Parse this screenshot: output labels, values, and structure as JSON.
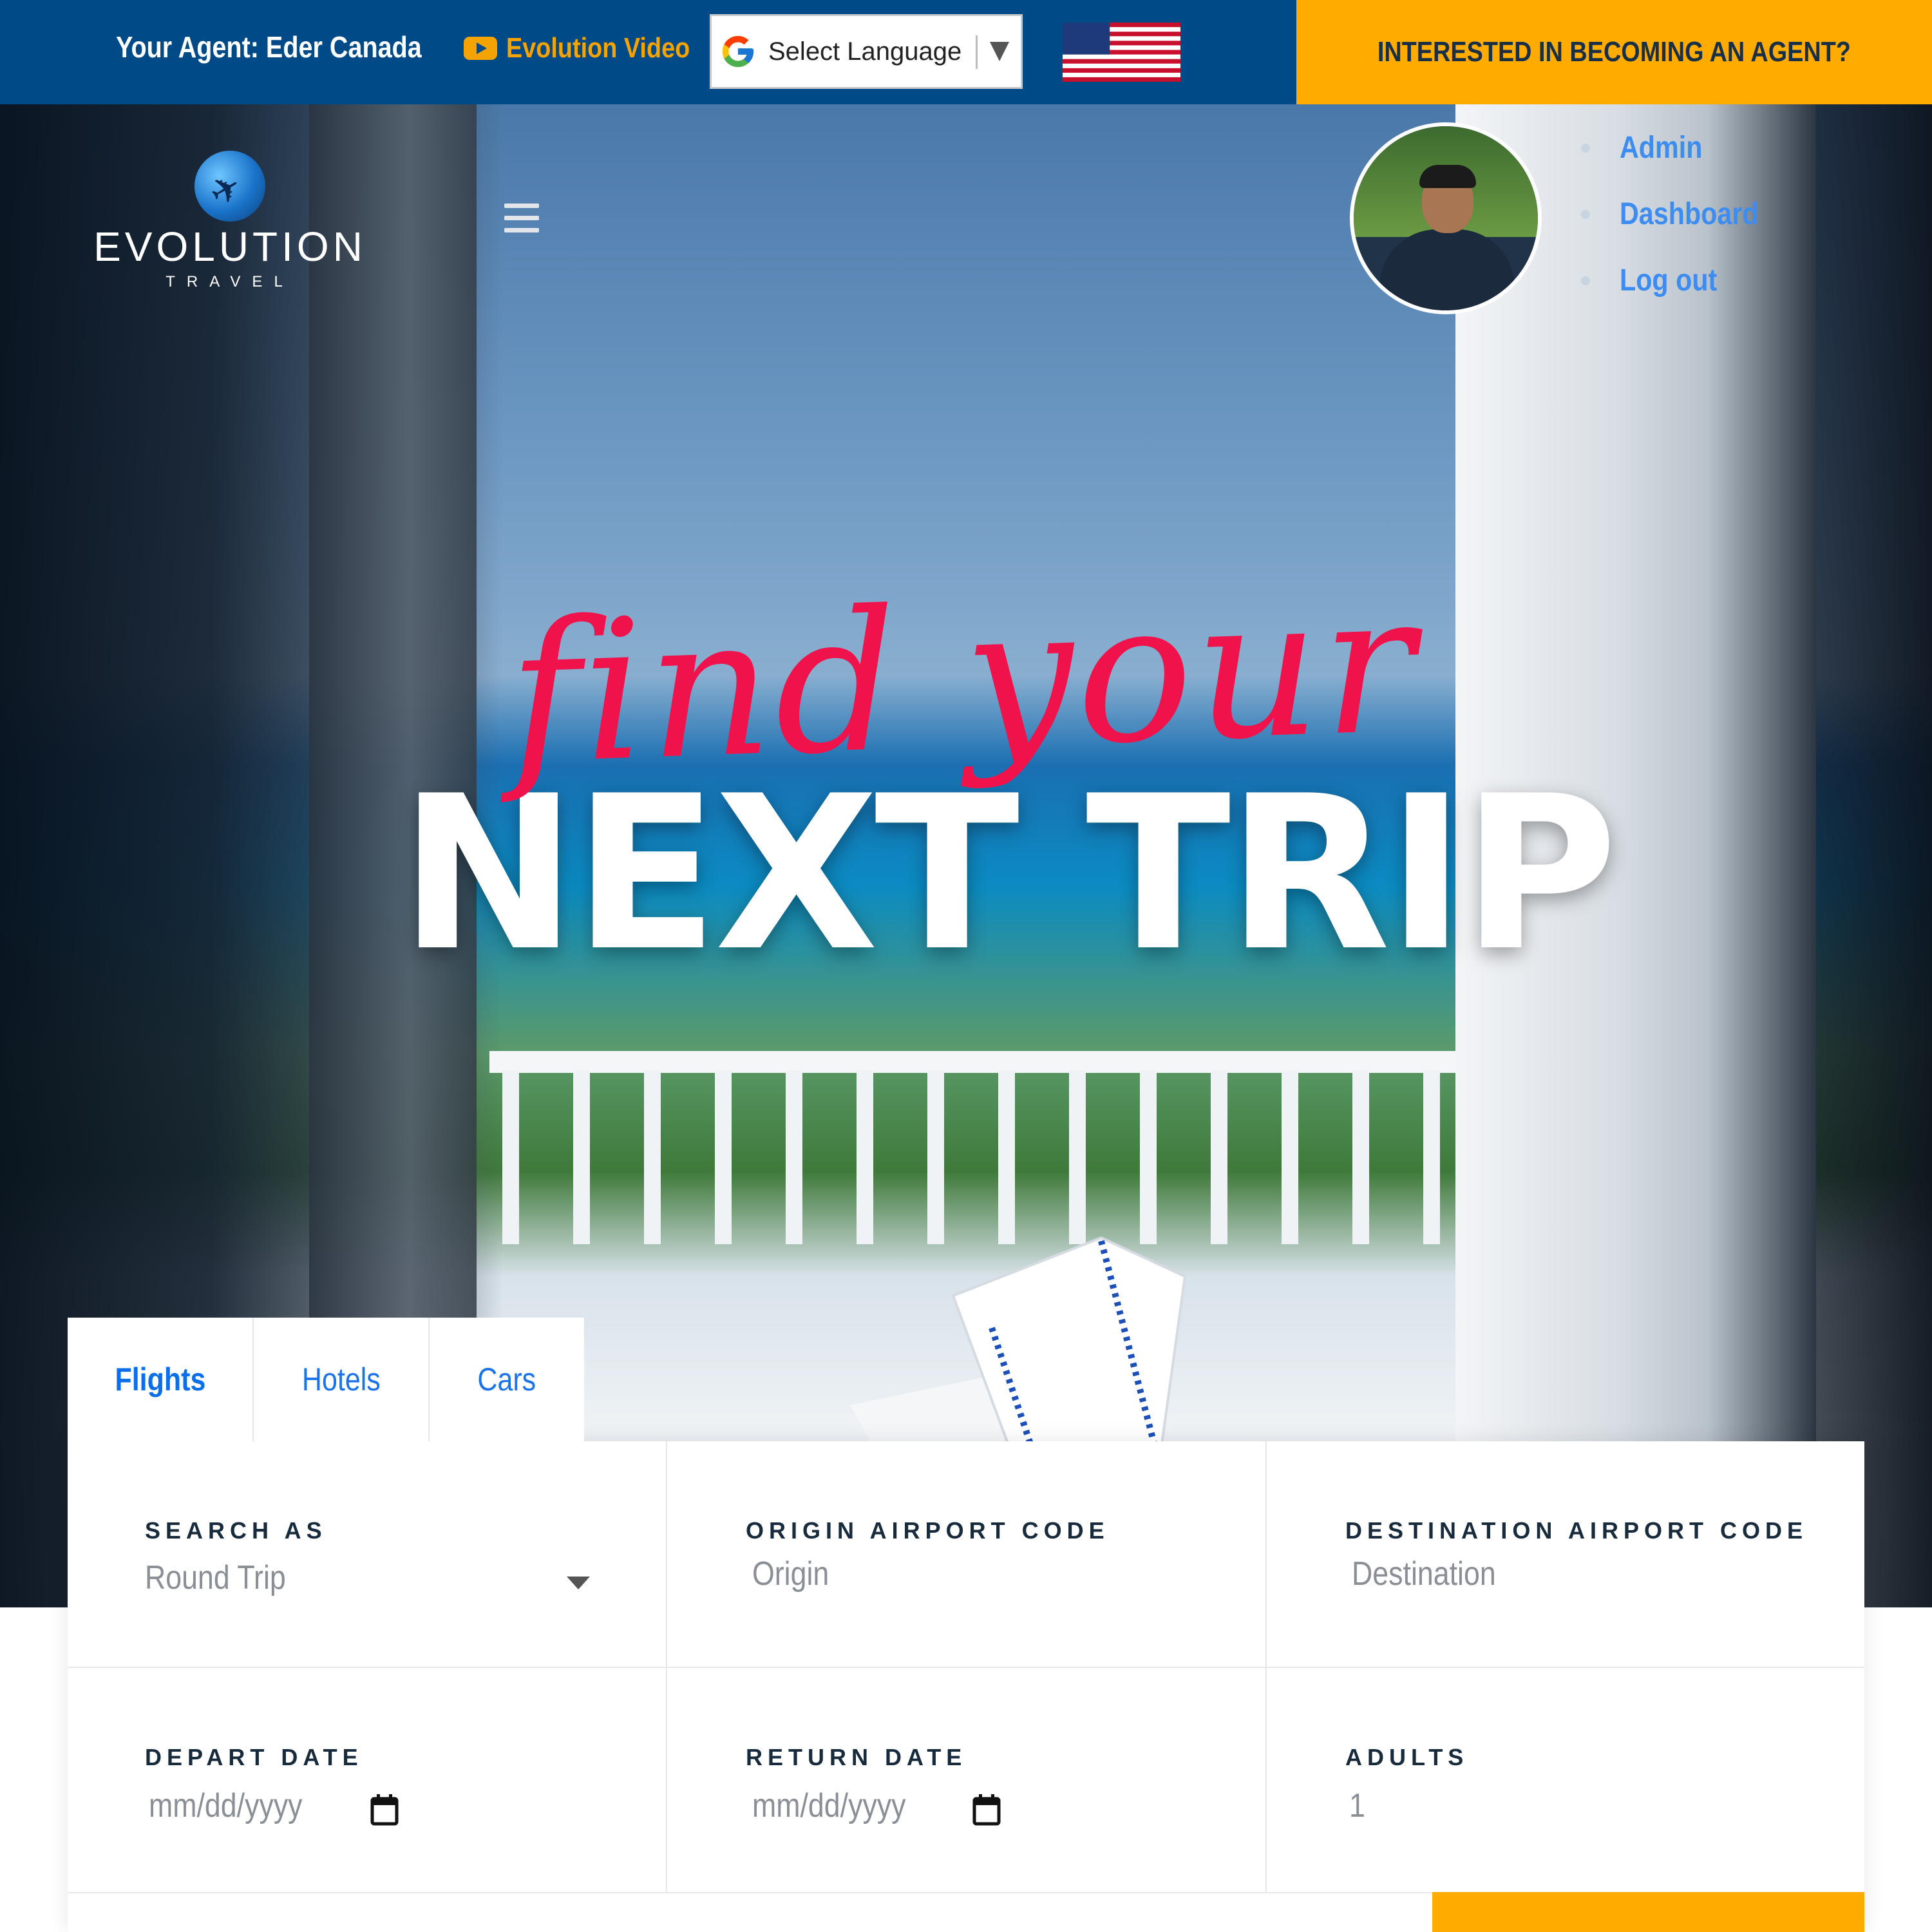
{
  "topbar": {
    "agent_label": "Your Agent: Eder Canada",
    "video_icon": "youtube-icon",
    "video_label": "Evolution Video",
    "language_select": "Select Language",
    "language_icon": "google-icon",
    "flag_icon": "us-flag-icon",
    "become_agent_label": "INTERESTED IN BECOMING AN AGENT?"
  },
  "brand": {
    "name": "EVOLUTION",
    "sub": "TRAVEL",
    "logo_icon": "globe-plane-logo"
  },
  "nav": {
    "menu_icon": "hamburger-icon",
    "user_menu": [
      "Admin",
      "Dashboard",
      "Log out"
    ]
  },
  "hero": {
    "script_line": "find your",
    "main_line": "NEXT TRIP"
  },
  "search": {
    "tabs": [
      "Flights",
      "Hotels",
      "Cars"
    ],
    "active_tab": "Flights",
    "fields": {
      "search_as": {
        "label": "SEARCH AS",
        "value": "Round Trip"
      },
      "origin": {
        "label": "ORIGIN AIRPORT CODE",
        "placeholder": "Origin"
      },
      "destination": {
        "label": "DESTINATION AIRPORT CODE",
        "placeholder": "Destination"
      },
      "depart": {
        "label": "DEPART DATE",
        "placeholder": "mm/dd/yyyy",
        "icon": "calendar-icon"
      },
      "return": {
        "label": "RETURN DATE",
        "placeholder": "mm/dd/yyyy",
        "icon": "calendar-icon"
      },
      "adults": {
        "label": "ADULTS",
        "value": "1"
      }
    }
  },
  "colors": {
    "topbar": "#004a87",
    "accent_orange": "#ffab00",
    "link_blue": "#3d8cf0",
    "headline_red": "#f0124a"
  }
}
